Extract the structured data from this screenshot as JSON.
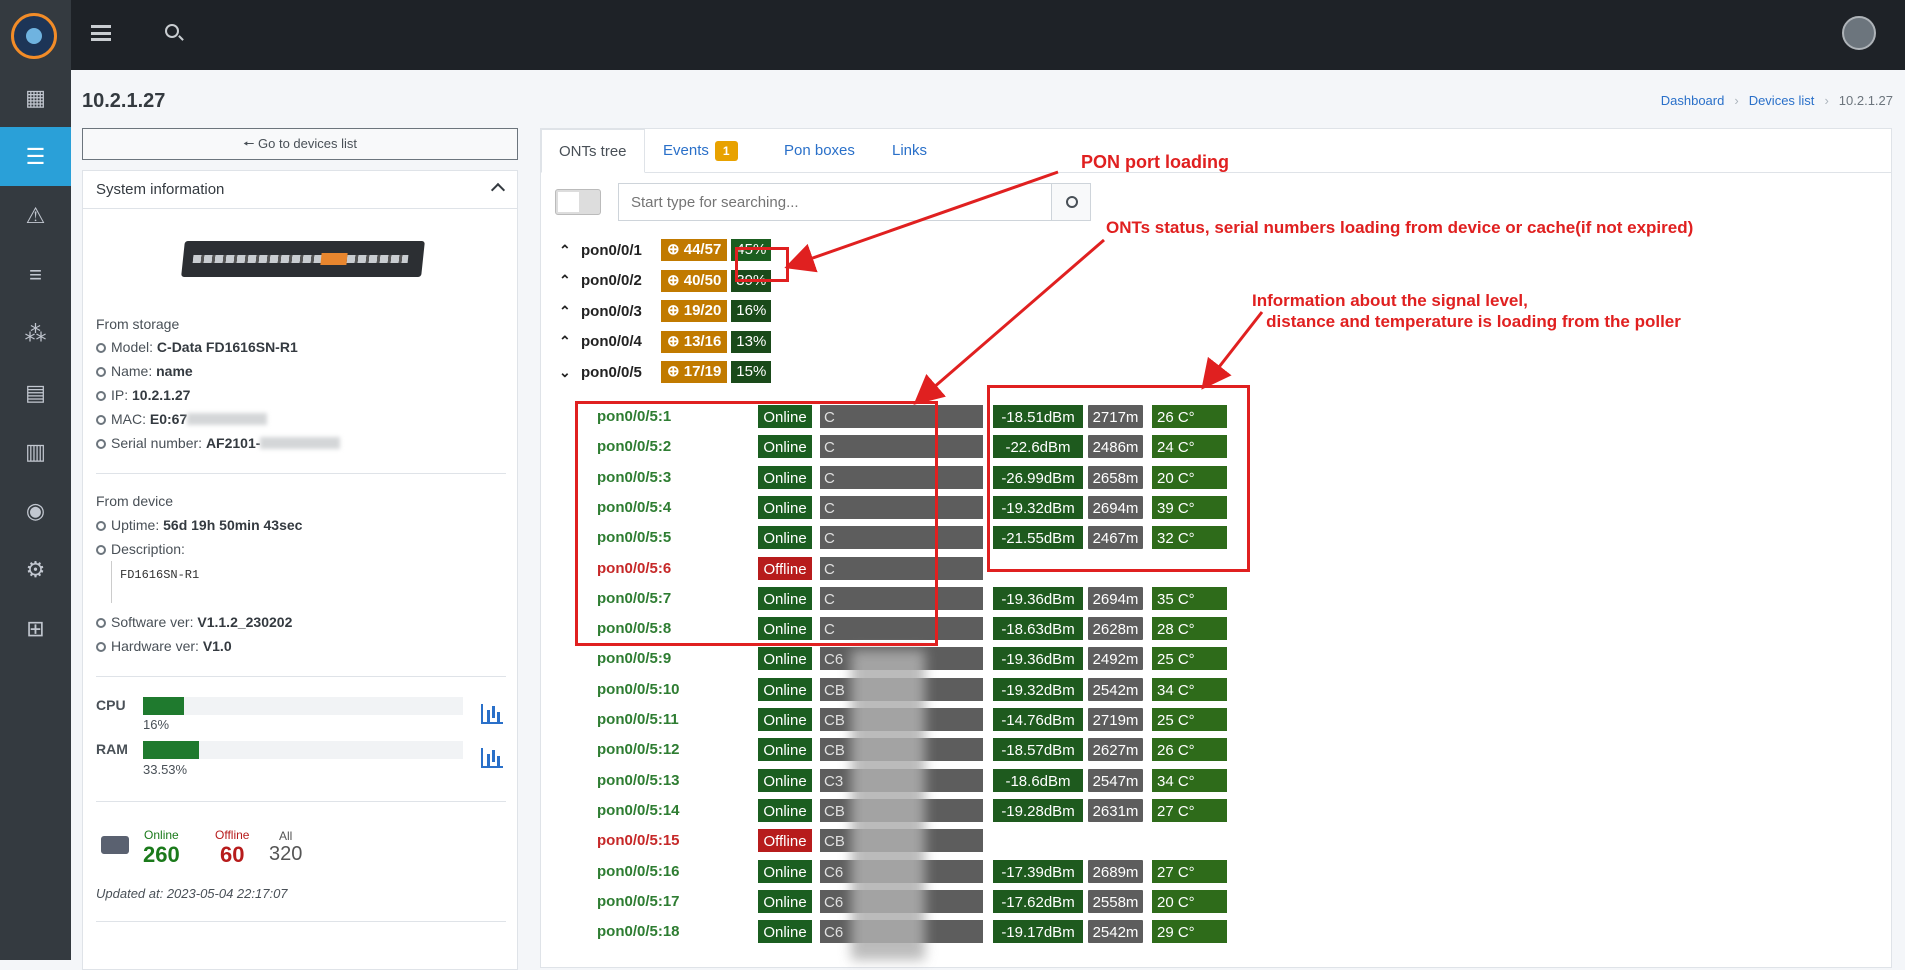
{
  "header": {
    "title": "10.2.1.27"
  },
  "breadcrumb": [
    "Dashboard",
    "Devices list",
    "10.2.1.27"
  ],
  "sidebar": {
    "items": [
      "dashboard-icon",
      "tree-icon",
      "alert-icon",
      "search-list-icon",
      "topology-icon",
      "document-icon",
      "chart-icon",
      "users-icon",
      "settings-icon",
      "apps-icon"
    ]
  },
  "goto_label": "Go to devices list",
  "system": {
    "title": "System information",
    "storage_title": "From storage",
    "model_label": "Model:",
    "model": "C-Data FD1616SN-R1",
    "name_label": "Name:",
    "name": "name",
    "ip_label": "IP:",
    "ip": "10.2.1.27",
    "mac_label": "MAC:",
    "mac": "E0:67",
    "serial_label": "Serial number:",
    "serial": "AF2101-",
    "device_title": "From device",
    "uptime_label": "Uptime:",
    "uptime": "56d 19h 50min 43sec",
    "description_label": "Description:",
    "description": "FD1616SN-R1",
    "software_label": "Software ver:",
    "software": "V1.1.2_230202",
    "hardware_label": "Hardware ver:",
    "hardware": "V1.0",
    "cpu_label": "CPU",
    "cpu": "16%",
    "cpu_level": 0.16,
    "ram_label": "RAM",
    "ram": "33.53%",
    "ram_level": 0.3353,
    "online_label": "Online",
    "online": "260",
    "offline_label": "Offline",
    "offline": "60",
    "all_label": "All",
    "all": "320",
    "updated": "Updated at: 2023-05-04 22:17:07"
  },
  "tabs": [
    {
      "label": "ONTs tree"
    },
    {
      "label": "Events",
      "badge": "1"
    },
    {
      "label": "Pon boxes"
    },
    {
      "label": "Links"
    }
  ],
  "search_placeholder": "Start type for searching...",
  "ports": [
    {
      "name": "pon0/0/1",
      "count": "44/57",
      "pct": "45%",
      "expanded": false
    },
    {
      "name": "pon0/0/2",
      "count": "40/50",
      "pct": "39%",
      "expanded": false
    },
    {
      "name": "pon0/0/3",
      "count": "19/20",
      "pct": "16%",
      "expanded": false
    },
    {
      "name": "pon0/0/4",
      "count": "13/16",
      "pct": "13%",
      "expanded": false
    },
    {
      "name": "pon0/0/5",
      "count": "17/19",
      "pct": "15%",
      "expanded": true
    }
  ],
  "onus": [
    {
      "name": "pon0/0/5:1",
      "status": "Online",
      "sn": "C",
      "signal": "-18.51dBm",
      "dist": "2717m",
      "temp": "26 C°"
    },
    {
      "name": "pon0/0/5:2",
      "status": "Online",
      "sn": "C",
      "signal": "-22.6dBm",
      "dist": "2486m",
      "temp": "24 C°"
    },
    {
      "name": "pon0/0/5:3",
      "status": "Online",
      "sn": "C",
      "signal": "-26.99dBm",
      "dist": "2658m",
      "temp": "20 C°"
    },
    {
      "name": "pon0/0/5:4",
      "status": "Online",
      "sn": "C",
      "signal": "-19.32dBm",
      "dist": "2694m",
      "temp": "39 C°"
    },
    {
      "name": "pon0/0/5:5",
      "status": "Online",
      "sn": "C",
      "signal": "-21.55dBm",
      "dist": "2467m",
      "temp": "32 C°"
    },
    {
      "name": "pon0/0/5:6",
      "status": "Offline",
      "sn": "C",
      "signal": "",
      "dist": "",
      "temp": ""
    },
    {
      "name": "pon0/0/5:7",
      "status": "Online",
      "sn": "C",
      "signal": "-19.36dBm",
      "dist": "2694m",
      "temp": "35 C°"
    },
    {
      "name": "pon0/0/5:8",
      "status": "Online",
      "sn": "C",
      "signal": "-18.63dBm",
      "dist": "2628m",
      "temp": "28 C°"
    },
    {
      "name": "pon0/0/5:9",
      "status": "Online",
      "sn": "C6",
      "signal": "-19.36dBm",
      "dist": "2492m",
      "temp": "25 C°"
    },
    {
      "name": "pon0/0/5:10",
      "status": "Online",
      "sn": "CB",
      "signal": "-19.32dBm",
      "dist": "2542m",
      "temp": "34 C°"
    },
    {
      "name": "pon0/0/5:11",
      "status": "Online",
      "sn": "CB",
      "signal": "-14.76dBm",
      "dist": "2719m",
      "temp": "25 C°"
    },
    {
      "name": "pon0/0/5:12",
      "status": "Online",
      "sn": "CB",
      "signal": "-18.57dBm",
      "dist": "2627m",
      "temp": "26 C°"
    },
    {
      "name": "pon0/0/5:13",
      "status": "Online",
      "sn": "C3",
      "signal": "-18.6dBm",
      "dist": "2547m",
      "temp": "34 C°"
    },
    {
      "name": "pon0/0/5:14",
      "status": "Online",
      "sn": "CB",
      "signal": "-19.28dBm",
      "dist": "2631m",
      "temp": "27 C°"
    },
    {
      "name": "pon0/0/5:15",
      "status": "Offline",
      "sn": "CB",
      "signal": "",
      "dist": "",
      "temp": ""
    },
    {
      "name": "pon0/0/5:16",
      "status": "Online",
      "sn": "C6",
      "signal": "-17.39dBm",
      "dist": "2689m",
      "temp": "27 C°"
    },
    {
      "name": "pon0/0/5:17",
      "status": "Online",
      "sn": "C6",
      "signal": "-17.62dBm",
      "dist": "2558m",
      "temp": "20 C°"
    },
    {
      "name": "pon0/0/5:18",
      "status": "Online",
      "sn": "C6",
      "signal": "-19.17dBm",
      "dist": "2542m",
      "temp": "29 C°"
    }
  ],
  "annotations": {
    "pon_loading": "PON port loading",
    "onts_status": "ONTs status, serial numbers loading from device or cache(if not expired)",
    "signal_info": "Information about the signal level,\n   distance and temperature is loading from the poller"
  },
  "colors": {
    "sidebar": "#343a40",
    "topbar": "#1e2227",
    "active": "#2aa0d8",
    "online": "#1b5e20",
    "offline": "#b71c1c",
    "annotation": "#e02020"
  }
}
